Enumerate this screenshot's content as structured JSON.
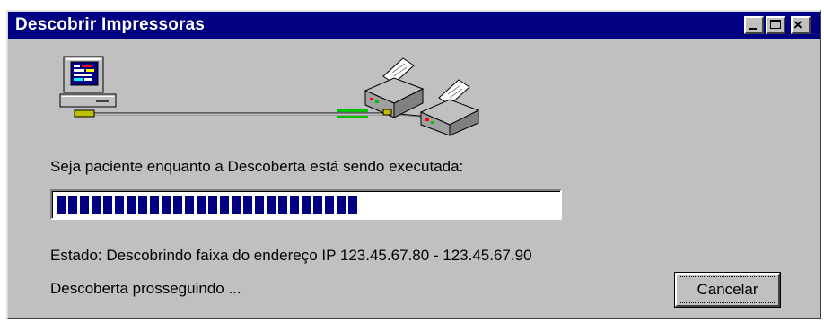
{
  "window": {
    "title": "Descobrir Impressoras",
    "controls": {
      "minimize_icon": "minimize-icon",
      "maximize_icon": "maximize-icon",
      "close_glyph": "×"
    }
  },
  "illustration": {
    "icons": [
      "computer-icon",
      "network-cable",
      "printer-icon",
      "printer-icon"
    ]
  },
  "messages": {
    "wait": "Seja paciente enquanto a Descoberta está sendo executada:",
    "state": "Estado:  Descobrindo faixa do endereço IP 123.45.67.80 - 123.45.67.90",
    "progress_text": "Descoberta prosseguindo ..."
  },
  "progress": {
    "fraction": 0.6,
    "color": "#000080"
  },
  "buttons": {
    "cancel_label": "Cancelar"
  },
  "colors": {
    "titlebar": "#000080",
    "face": "#c0c0c0",
    "activity": "#00c000"
  }
}
